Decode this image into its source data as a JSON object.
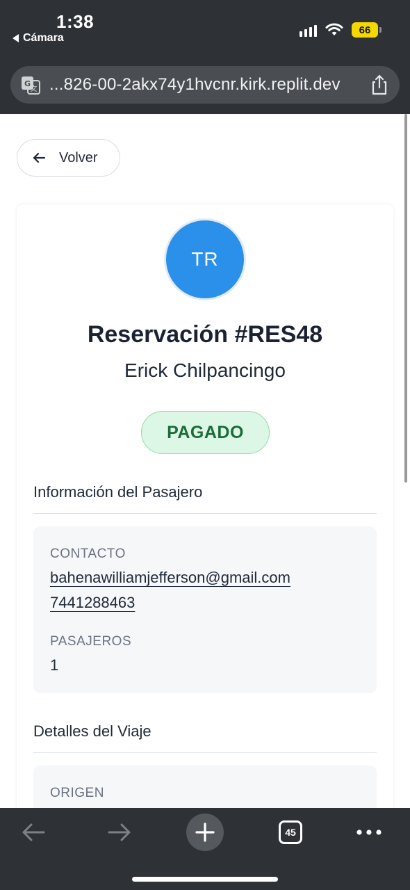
{
  "status_bar": {
    "time": "1:38",
    "back_app": "Cámara",
    "battery": "66"
  },
  "browser": {
    "url": "...826-00-2akx74y1hvcnr.kirk.replit.dev",
    "tab_count": "45"
  },
  "page": {
    "back_label": "Volver",
    "avatar_initials": "TR",
    "title": "Reservación #RES48",
    "customer_name": "Erick Chilpancingo",
    "status": "PAGADO",
    "passenger_section": {
      "title": "Información del Pasajero",
      "contact_label": "CONTACTO",
      "email": "bahenawilliamjefferson@gmail.com",
      "phone": "7441288463",
      "passengers_label": "PASAJEROS",
      "passengers_value": "1"
    },
    "trip_section": {
      "title": "Detalles del Viaje",
      "origin_label": "ORIGEN"
    }
  },
  "colors": {
    "avatar": "#2b90ea",
    "status_bg": "#dcf7e6",
    "status_text": "#1d6b3a",
    "battery": "#f5d800",
    "chrome": "#2e3136"
  }
}
